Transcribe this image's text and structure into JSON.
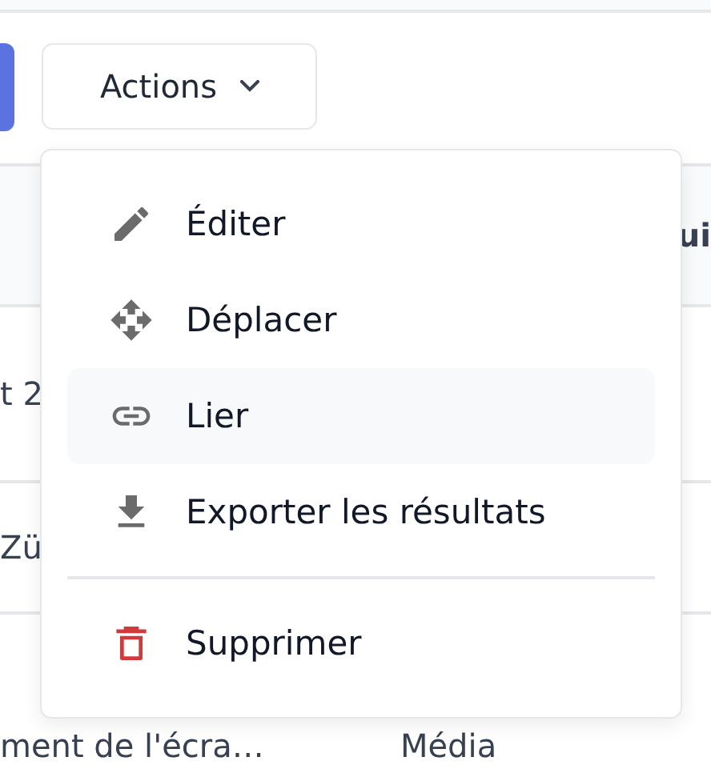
{
  "toolbar": {
    "actions_button": {
      "label": "Actions",
      "expanded": true
    }
  },
  "table": {
    "header": {
      "column_3": "ui"
    },
    "rows": [
      {
        "column_1": "t 2"
      },
      {
        "column_1": "Zü"
      },
      {
        "column_1": "ment de l'écra…",
        "column_2": "Média"
      }
    ]
  },
  "menu": {
    "items": [
      {
        "label": "Éditer",
        "kind": "action",
        "highlighted": false
      },
      {
        "label": "Déplacer",
        "kind": "action",
        "highlighted": false
      },
      {
        "label": "Lier",
        "kind": "action",
        "highlighted": true
      },
      {
        "label": "Exporter les résultats",
        "kind": "action",
        "highlighted": false
      },
      {
        "label": "Supprimer",
        "kind": "danger",
        "highlighted": false
      }
    ]
  }
}
